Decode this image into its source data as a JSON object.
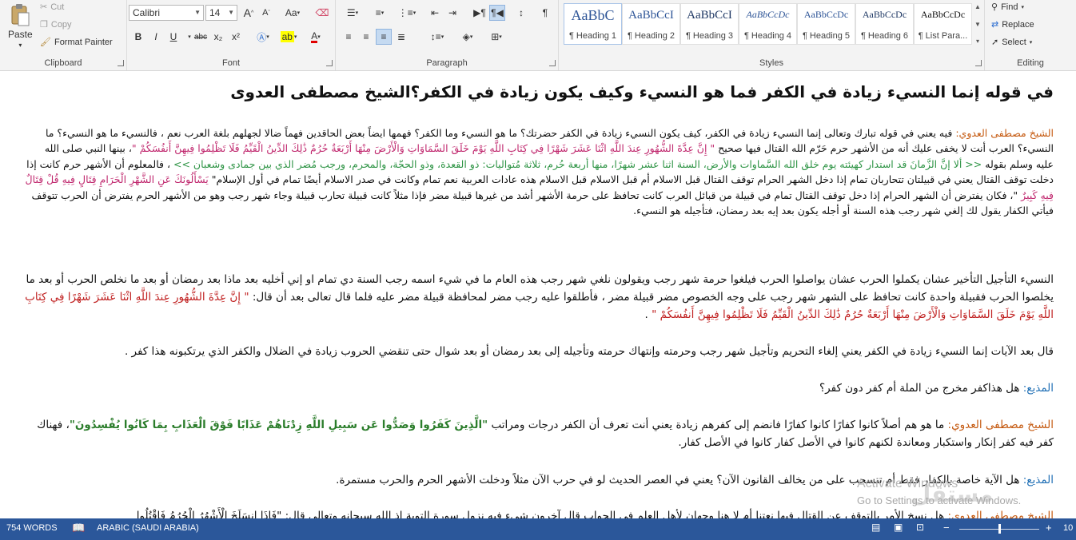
{
  "ribbon": {
    "clipboard": {
      "paste": "Paste",
      "cut": "Cut",
      "copy": "Copy",
      "format_painter": "Format Painter",
      "label": "Clipboard"
    },
    "font": {
      "name": "Calibri",
      "size": "14",
      "grow": "A",
      "shrink": "A",
      "case": "Aa",
      "bold": "B",
      "italic": "I",
      "underline": "U",
      "strike": "abc",
      "sub": "x₂",
      "sup": "x²",
      "label": "Font"
    },
    "paragraph": {
      "label": "Paragraph",
      "pilcrow": "¶"
    },
    "styles": {
      "label": "Styles",
      "items": [
        {
          "sample": "AaBbC",
          "name": "¶ Heading 1"
        },
        {
          "sample": "AaBbCcI",
          "name": "¶ Heading 2"
        },
        {
          "sample": "AaBbCcI",
          "name": "¶ Heading 3"
        },
        {
          "sample": "AaBbCcDc",
          "name": "¶ Heading 4"
        },
        {
          "sample": "AaBbCcDc",
          "name": "¶ Heading 5"
        },
        {
          "sample": "AaBbCcDc",
          "name": "¶ Heading 6"
        },
        {
          "sample": "AaBbCcDc",
          "name": "¶ List Para..."
        }
      ]
    },
    "editing": {
      "label": "Editing",
      "find": "Find",
      "replace": "Replace",
      "select": "Select"
    }
  },
  "document": {
    "title": "في قوله إنما النسيء زيادة في الكفر فما هو النسيء وكيف يكون زيادة في الكفر؟الشيخ مصطفى العدوى",
    "p1": {
      "speaker": "الشيخ مصطفى العدوي:",
      "text1": " فيه يعني في قوله تبارك وتعالى إنما النسيء زيادة في الكفر، كيف يكون النسيء زيادة في الكفر حضرتك؟ ما هو النسيء وما الكفر؟ فهمها ايضاً بعض الحاقدين فهماً ضالا لجهلهم بلغة العرب نعم ، فالنسيء ما هو النسيء؟ ما النسيء؟ العرب أنت لا يخفى عليك أنه من الأشهر حرم حَرّم الله القتال فيها صحيح ",
      "quote1": "\" إِنَّ عِدَّةَ الشُّهُورِ عِندَ اللَّهِ اثْنَا عَشَرَ شَهْرًا فِي كِتَابِ اللَّهِ يَوْمَ خَلَقَ السَّمَاوَاتِ وَالْأَرْضَ مِنْهَا أَرْبَعَةٌ حُرُمٌ ذَٰلِكَ الدِّينُ الْقَيِّمُ فَلَا تَظْلِمُوا فِيهِنَّ أَنفُسَكُمْ \"",
      "text2": "، بينها النبي صلى الله عليه وسلم بقوله ",
      "quote2": "<< ألا إنَّ الزَّمانَ قد استدار كهيئته يوم خلق الله السَّماوات والأرض، السنة اثنا عشر شهرًا، منها أربعة حُرم، ثلاثة مُتواليات: ذو القعدة، وذو الحجّة، والمحرم، ورجب مُضر الذي بين جمادى وشعبان >>",
      "text3": " ، فالمعلوم أن الأشهر حرم كانت إذا دخلت توقف القتال يعني في قبيلتان تتحاربان تمام إذا دخل الشهر الحرام توقف القتال قبل الاسلام أم قبل الاسلام قبل الاسلام هذه عادات العربية نعم تمام وكانت في صدر الاسلام أيضًا تمام في أول الإسلام\" ",
      "quote3": "يَسْأَلُونَكَ عَنِ الشَّهْرِ الْحَرَامِ قِتَالٍ فِيهِ قُلْ قِتَالٌ فِيهِ كَبِيرٌ",
      "text4": " \"، فكان يفترض أن الشهر الحرام إذا دخل توقف القتال تمام في قبيلة من قبائل العرب كانت تحافظ على حرمة الأشهر أشد من غيرها قبيلة مضر فإذا مثلاً كانت قبيلة تحارب قبيلة وجاء شهر رجب وهو من الأشهر الحرم يفترض أن الحرب تتوقف فيأتي الكفار يقول لك إلغي شهر رجب هذه السنة أو أجله يكون بعد إيه بعد رمضان، فتأجيله هو النسيء."
    },
    "p2": {
      "text1": "النسيء التأجيل التأخير عشان يكملوا الحرب عشان يواصلوا الحرب فيلغوا حرمة شهر رجب ويقولون نلغي شهر رجب هذه العام ما في شيء اسمه رجب السنة دي تمام او إني أخليه بعد ماذا بعد رمضان أو بعد ما نخلص الحرب أو بعد ما يخلصوا الحرب فقبيلة واحدة كانت تحافظ على الشهر شهر رجب على وجه الخصوص مضر قبيلة مضر ، فأطلقوا عليه رجب مضر لمحافظة قبيلة مضر عليه فلما قال تعالى بعد أن قال: ",
      "quote": "\" إِنَّ عِدَّةَ الشُّهُورِ عِندَ اللَّهِ اثْنَا عَشَرَ شَهْرًا فِي كِتَابِ اللَّهِ يَوْمَ خَلَقَ السَّمَاوَاتِ وَالْأَرْضَ مِنْهَا أَرْبَعَةٌ حُرُمٌ ذَٰلِكَ الدِّينُ الْقَيِّمُ فَلَا تَظْلِمُوا فِيهِنَّ أَنفُسَكُمْ \"",
      "end": " ."
    },
    "p3": "قال بعد الآيات إنما النسيء زيادة في الكفر يعني إلغاء التحريم وتأجيل شهر رجب وحرمته وإنتهاك حرمته وتأجيله إلى بعد رمضان أو بعد شوال حتى تنقضي الحروب زيادة في الضلال والكفر الذي يرتكبونه هذا كفر .",
    "p4": {
      "speaker": "المذيع:",
      "text": " هل هذاكفر مخرج من الملة أم كفر دون كفر؟"
    },
    "p5": {
      "speaker": "الشيخ مصطفى العدوي:",
      "text1": "  ما هو هم أصلاً كانوا كفارًا كانوا كفارًا فانضم إلى كفرهم زيادة يعني أنت تعرف أن الكفر درجات ومراتب ",
      "quote": "\"الَّذِينَ كَفَرُوا وَصَدُّوا عَن سَبِيلِ اللَّهِ زِدْنَاهُمْ عَذَابًا فَوْقَ الْعَذَابِ بِمَا كَانُوا يُفْسِدُونَ\"",
      "text2": "، فهناك كفر فيه كفر إنكار واستكبار ومعاندة لكنهم كانوا في الأصل كفار كانوا في الأصل كفار."
    },
    "p6": {
      "speaker": "المذيع:",
      "text": "  هل الآية خاصة بالكفار فقط أم تنسحب على من يخالف القانون الآن؟ يعني في العصر الحديث لو في حرب الآن مثلاً ودخلت الأشهر الحرم والحرب مستمرة."
    },
    "p7": {
      "speaker": "الشيخ مصطفى العدوي:",
      "text": " هل نسخ الأمر بالتوقف عن القتال فيها نعتنا أم لا هنا وجهان لأهل العلم في الجواب قال آخرون شيء فيه نزول سورة التوبة إذ الله سبحانه وتعالى قال: \"فَإِذَا انسَلَخَ الْأَشْهُرُ الْحُرُمُ فَاقْتُلُوا"
    }
  },
  "watermark": {
    "title": "Activate Windows",
    "subtitle": "Go to Settings to activate Windows."
  },
  "brand": "مستقل",
  "statusbar": {
    "words": "754 WORDS",
    "language": "ARABIC (SAUDI ARABIA)",
    "zoom": "10"
  }
}
